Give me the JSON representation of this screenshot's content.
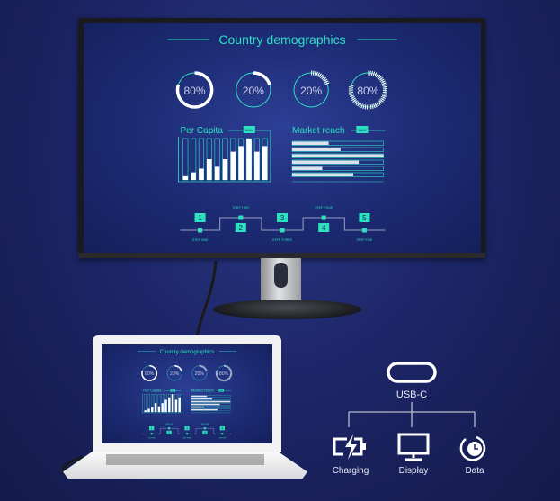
{
  "screen": {
    "title": "Country demographics",
    "rings": [
      {
        "label": "80%",
        "value": 80,
        "style": "solid"
      },
      {
        "label": "20%",
        "value": 20,
        "style": "solid"
      },
      {
        "label": "20%",
        "value": 20,
        "style": "dashed"
      },
      {
        "label": "80%",
        "value": 80,
        "style": "dashed"
      }
    ],
    "per_capita": {
      "title": "Per Capita",
      "badge": "MAX",
      "values": [
        2,
        4,
        6,
        11,
        7,
        11,
        15,
        18,
        22,
        15,
        18
      ],
      "max": 22
    },
    "market_reach": {
      "title": "Market reach",
      "badge": "MAX",
      "values": [
        40,
        53,
        100,
        73,
        33,
        67
      ]
    },
    "steps": [
      {
        "num": "1",
        "label": "STEP ONE"
      },
      {
        "num": "2",
        "label": "STEP TWO"
      },
      {
        "num": "3",
        "label": "STEP THREE"
      },
      {
        "num": "4",
        "label": "STEP FOUR"
      },
      {
        "num": "5",
        "label": "STEP FIVE"
      }
    ]
  },
  "usb": {
    "title": "USB-C",
    "items": [
      {
        "label": "Charging",
        "icon": "charging-battery-icon"
      },
      {
        "label": "Display",
        "icon": "monitor-icon"
      },
      {
        "label": "Data",
        "icon": "clock-sync-icon"
      }
    ]
  },
  "colors": {
    "accent": "#2de0c0",
    "background": "#1d2668",
    "text": "#ffffff"
  }
}
